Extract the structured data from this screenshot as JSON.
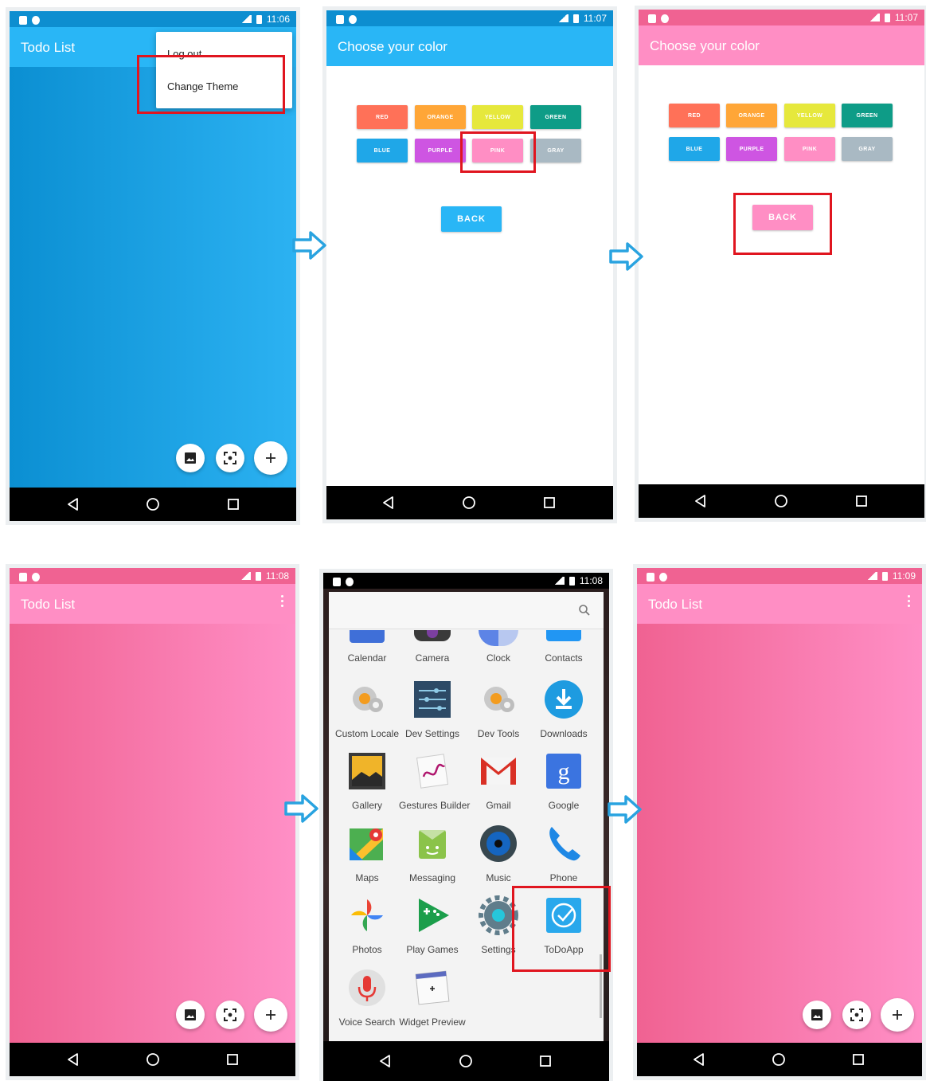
{
  "status": {
    "p1_time": "11:06",
    "p2_time": "11:07",
    "p3_time": "11:07",
    "p4_time": "11:08",
    "p5_time": "11:08",
    "p6_time": "11:09"
  },
  "todo": {
    "title": "Todo List"
  },
  "menu": {
    "logout": "Log out",
    "change_theme": "Change Theme"
  },
  "theme_screen": {
    "title": "Choose your color",
    "colors": [
      {
        "label": "RED",
        "hex": "#ff7158"
      },
      {
        "label": "ORANGE",
        "hex": "#ffa637"
      },
      {
        "label": "YELLOW",
        "hex": "#e6e83c"
      },
      {
        "label": "GREEN",
        "hex": "#0e9c87"
      },
      {
        "label": "BLUE",
        "hex": "#1fa7e8"
      },
      {
        "label": "PURPLE",
        "hex": "#ce55e2"
      },
      {
        "label": "PINK",
        "hex": "#ff8ec4"
      },
      {
        "label": "GRAY",
        "hex": "#a9b9c3"
      }
    ],
    "back": "BACK"
  },
  "launcher": {
    "partial_row": [
      "Calendar",
      "Camera",
      "Clock",
      "Contacts"
    ],
    "rows": [
      [
        "Custom Locale",
        "Dev Settings",
        "Dev Tools",
        "Downloads"
      ],
      [
        "Gallery",
        "Gestures Builder",
        "Gmail",
        "Google"
      ],
      [
        "Maps",
        "Messaging",
        "Music",
        "Phone"
      ],
      [
        "Photos",
        "Play Games",
        "Settings",
        "ToDoApp"
      ],
      [
        "Voice Search",
        "Widget Preview"
      ]
    ]
  },
  "theme_colors": {
    "blue_bar": "#29b6f6",
    "blue_status": "#039be5",
    "pink_bar": "#ff8ec4",
    "pink_status": "#f06292",
    "highlight": "#e0151f",
    "arrow": "#29a3e0"
  }
}
